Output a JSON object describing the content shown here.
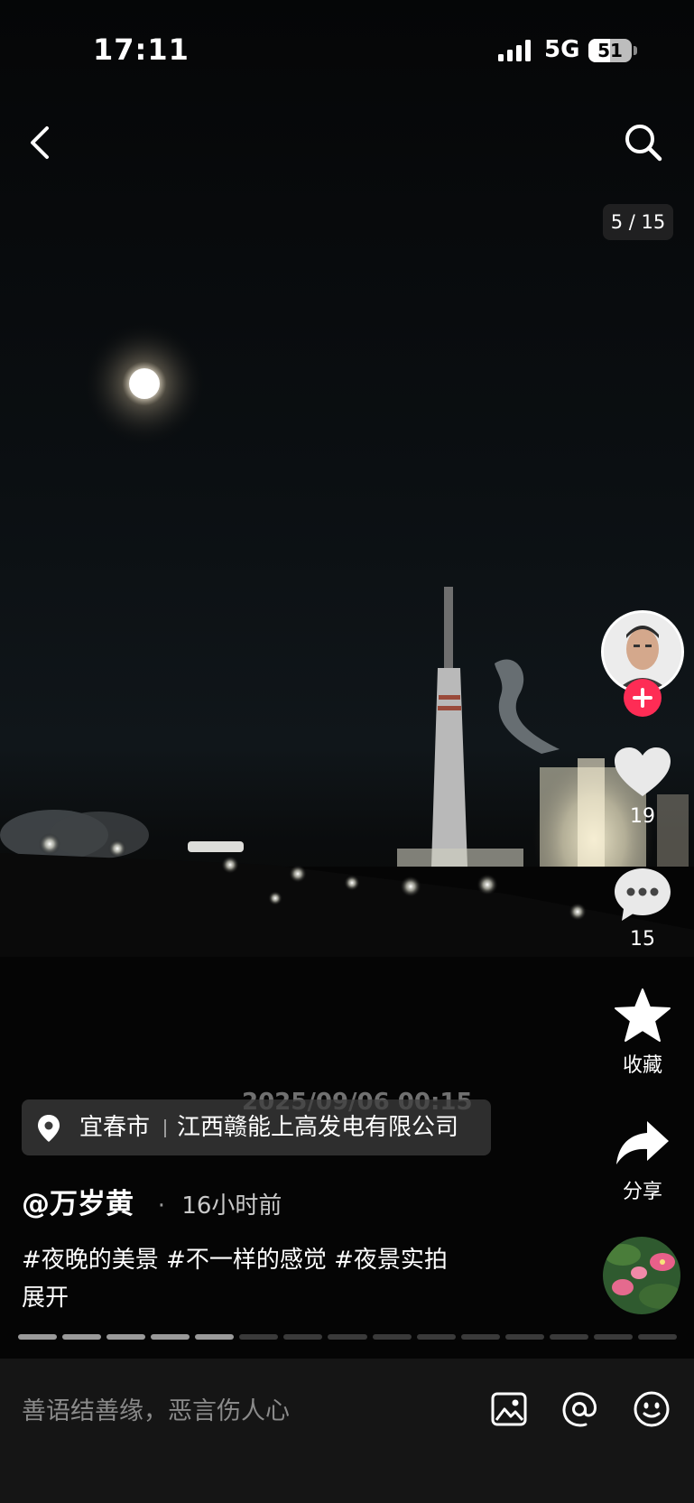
{
  "status_bar": {
    "time": "17:11",
    "network": "5G",
    "battery_percent": "51",
    "battery_level": 0.51
  },
  "viewer": {
    "counter": "5 / 15",
    "watermark": "2025/09/06 00:15"
  },
  "right_rail": {
    "like_count": "19",
    "comment_count": "15",
    "favorite_label": "收藏",
    "share_label": "分享"
  },
  "location": {
    "city": "宜春市",
    "place": "江西赣能上高发电有限公司"
  },
  "post": {
    "author": "@万岁黄",
    "dot": "·",
    "time_ago": "16小时前",
    "hashtags": "#夜晚的美景 #不一样的感觉 #夜景实拍",
    "expand": "展开"
  },
  "progress": {
    "total_segments": 15,
    "current_segment": 5
  },
  "comment_bar": {
    "placeholder": "善语结善缘，恶言伤人心"
  },
  "icons": [
    "back-icon",
    "search-icon",
    "heart-icon",
    "comment-icon",
    "star-icon",
    "share-icon",
    "location-pin-icon",
    "image-icon",
    "at-icon",
    "emoji-icon",
    "plus-icon"
  ],
  "colors": {
    "accent": "#fe2c55",
    "background": "#000000",
    "comment_bar": "#151515"
  }
}
